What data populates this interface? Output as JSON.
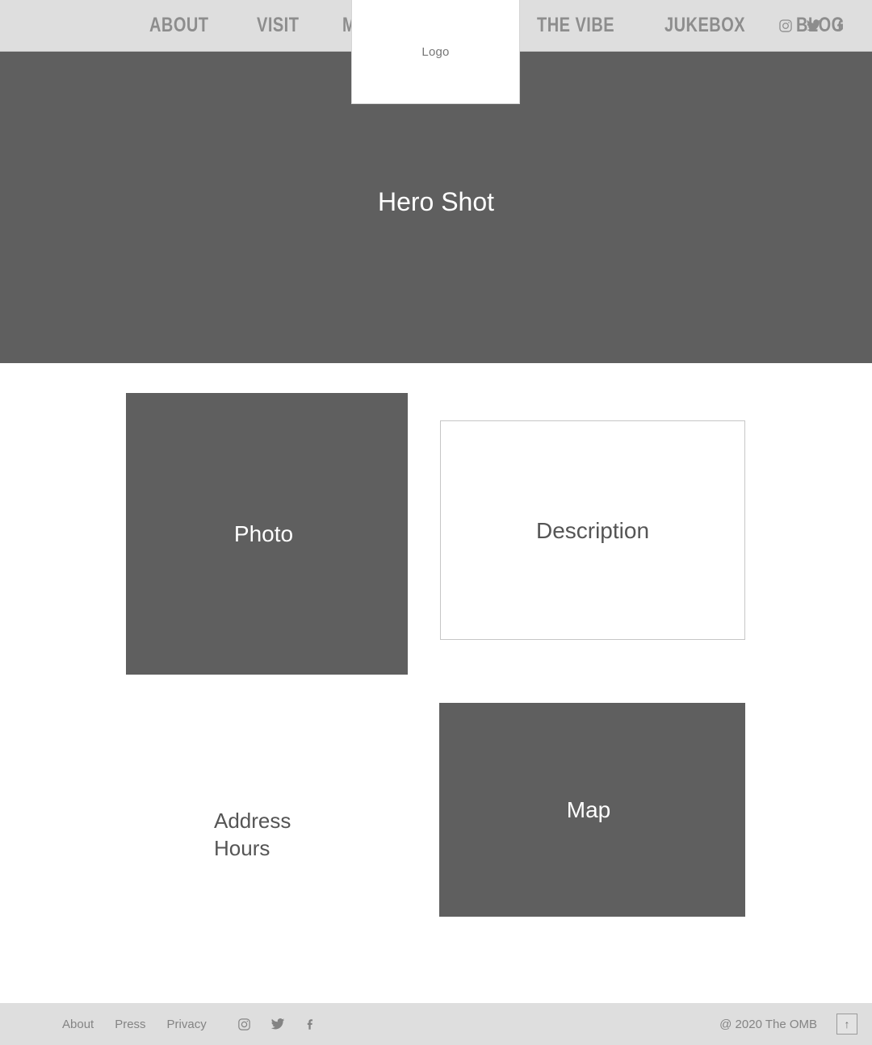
{
  "header": {
    "nav_left": [
      {
        "label": "ABOUT",
        "name": "nav-link-about"
      },
      {
        "label": "VISIT",
        "name": "nav-link-visit"
      },
      {
        "label": "MENU",
        "name": "nav-link-menu"
      }
    ],
    "nav_right": [
      {
        "label": "THE VIBE",
        "name": "nav-link-the-vibe"
      },
      {
        "label": "JUKEBOX",
        "name": "nav-link-jukebox"
      },
      {
        "label": "BLOG",
        "name": "nav-link-blog"
      }
    ],
    "socials": [
      {
        "icon": "instagram-icon"
      },
      {
        "icon": "twitter-icon"
      },
      {
        "icon": "facebook-icon"
      }
    ],
    "background_color": "#dedede",
    "link_color": "#8d8d8d"
  },
  "logo": {
    "label": "Logo",
    "background_color": "#ffffff",
    "border_color": "#d4d4d4"
  },
  "hero": {
    "label": "Hero Shot",
    "background_color": "#5f5f5f",
    "text_color": "#ffffff"
  },
  "main": {
    "photo": {
      "label": "Photo",
      "background_color": "#5f5f5f",
      "text_color": "#ffffff"
    },
    "description": {
      "label": "Description",
      "background_color": "#ffffff",
      "border_color": "#c6c6c6",
      "text_color": "#555555"
    },
    "address": {
      "line1": "Address",
      "line2": "Hours",
      "text_color": "#555555"
    },
    "map": {
      "label": "Map",
      "background_color": "#5f5f5f",
      "text_color": "#ffffff"
    }
  },
  "footer": {
    "links": [
      {
        "label": "About",
        "name": "footer-link-about"
      },
      {
        "label": "Press",
        "name": "footer-link-press"
      },
      {
        "label": "Privacy",
        "name": "footer-link-privacy"
      }
    ],
    "socials": [
      {
        "icon": "instagram-icon"
      },
      {
        "icon": "twitter-icon"
      },
      {
        "icon": "facebook-icon"
      }
    ],
    "copyright": "@ 2020 The OMB",
    "back_to_top_glyph": "↑",
    "background_color": "#dedede",
    "text_color": "#848484"
  }
}
